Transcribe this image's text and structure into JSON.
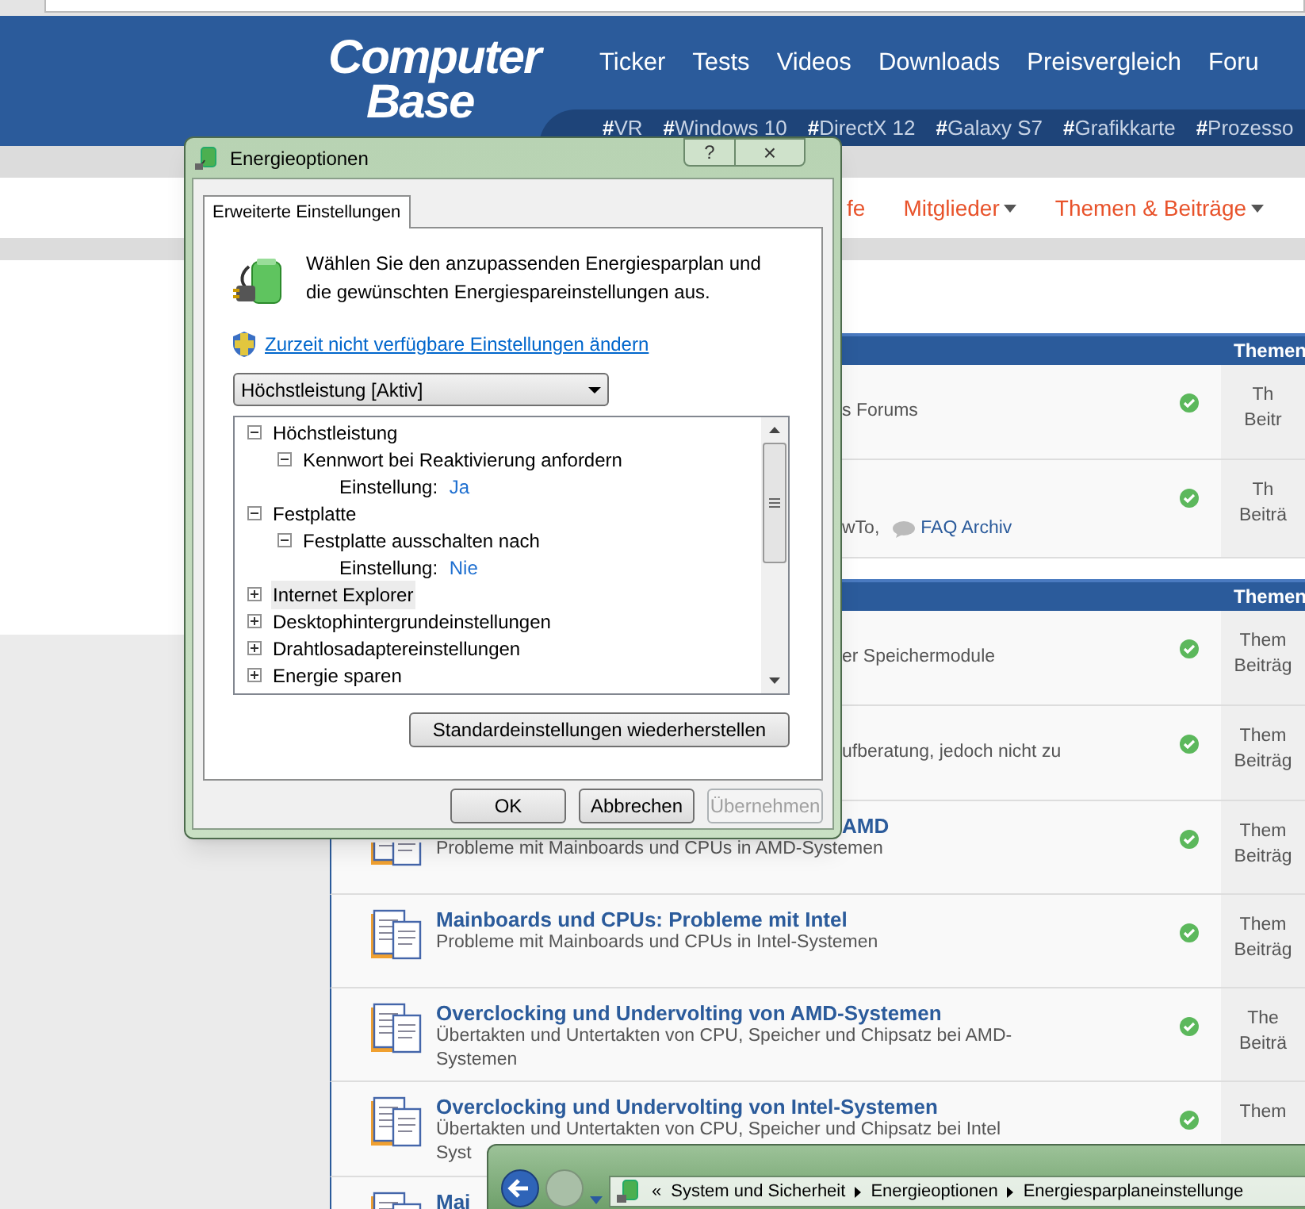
{
  "site": {
    "logo": {
      "line_1": "Computer",
      "line_2": "Base"
    },
    "nav": [
      "Ticker",
      "Tests",
      "Videos",
      "Downloads",
      "Preisvergleich",
      "Foru"
    ],
    "tags": [
      "VR",
      "Windows 10",
      "DirectX 12",
      "Galaxy S7",
      "Grafikkarte",
      "Prozesso"
    ],
    "tag_mark": "#",
    "subnav": [
      {
        "label": "fe",
        "dropdown": false
      },
      {
        "label": "Mitglieder",
        "dropdown": true
      },
      {
        "label": "Themen & Beiträge",
        "dropdown": true
      }
    ]
  },
  "forum_sections": [
    {
      "header": "Themen",
      "rows": [
        {
          "kind": "covered",
          "description": [
            "s Forums"
          ],
          "read": true,
          "stats": [
            "Th",
            "Beitr"
          ]
        },
        {
          "kind": "covered",
          "description": [
            "wTo,"
          ],
          "link": "FAQ Archiv",
          "read": true,
          "stats": [
            "Th",
            "Beiträ"
          ]
        }
      ]
    },
    {
      "header": "Themen",
      "rows": [
        {
          "kind": "covered",
          "description": [
            "er Speichermodule"
          ],
          "read": true,
          "stats": [
            "Them",
            "Beiträg"
          ]
        },
        {
          "kind": "covered",
          "description": [
            "ufberatung, jedoch nicht zu"
          ],
          "read": true,
          "stats": [
            "Them",
            "Beiträg"
          ]
        },
        {
          "kind": "title_covered",
          "title": "AMD",
          "description": [
            "Probleme mit Mainboards und CPUs in AMD-Systemen"
          ],
          "read": true,
          "stats": [
            "Them",
            "Beiträg"
          ]
        },
        {
          "kind": "full",
          "title": "Mainboards und CPUs: Probleme mit Intel",
          "description": [
            "Probleme mit Mainboards und CPUs in Intel-Systemen"
          ],
          "read": true,
          "stats": [
            "Them",
            "Beiträg"
          ]
        },
        {
          "kind": "full",
          "title": "Overclocking und Undervolting von AMD-Systemen",
          "description": [
            "Übertakten und Untertakten von CPU, Speicher und Chipsatz bei AMD-",
            "Systemen"
          ],
          "read": true,
          "stats": [
            "The",
            "Beiträ"
          ]
        },
        {
          "kind": "full",
          "title": "Overclocking und Undervolting von Intel-Systemen",
          "description": [
            "Übertakten und Untertakten von CPU, Speicher und Chipsatz bei Intel",
            "Syst"
          ],
          "read": true,
          "stats": [
            "Them"
          ]
        },
        {
          "kind": "full",
          "title": "Mai",
          "description": [],
          "stats": []
        }
      ]
    }
  ],
  "dialog": {
    "title": "Energieoptionen",
    "help": "?",
    "close": "×",
    "tabs": [
      {
        "label": "Erweiterte Einstellungen",
        "selected": true
      }
    ],
    "intro": "Wählen Sie den anzupassenden Energiesparplan und die gewünschten Energiespareinstellungen aus.",
    "admin_link": "Zurzeit nicht verfügbare Einstellungen ändern",
    "plan_select": {
      "value": "Höchstleistung [Aktiv]"
    },
    "tree": [
      {
        "label": "Höchstleistung",
        "expanded": true,
        "selected": false,
        "children": [
          {
            "label": "Kennwort bei Reaktivierung anfordern",
            "expanded": true,
            "selected": false,
            "children": [
              {
                "kind": "setting",
                "label": "Einstellung:",
                "value": "Ja",
                "selected": false
              }
            ]
          }
        ]
      },
      {
        "label": "Festplatte",
        "expanded": true,
        "selected": false,
        "children": [
          {
            "label": "Festplatte ausschalten nach",
            "expanded": true,
            "selected": false,
            "children": [
              {
                "kind": "setting",
                "label": "Einstellung:",
                "value": "Nie",
                "selected": false
              }
            ]
          }
        ]
      },
      {
        "label": "Internet Explorer",
        "expanded": false,
        "selected": true
      },
      {
        "label": "Desktophintergrundeinstellungen",
        "expanded": false,
        "selected": false
      },
      {
        "label": "Drahtlosadaptereinstellungen",
        "expanded": false,
        "selected": false
      },
      {
        "label": "Energie sparen",
        "expanded": false,
        "selected": false
      }
    ],
    "restore_button": "Standardeinstellungen wiederherstellen",
    "buttons": [
      {
        "label": "OK",
        "disabled": false
      },
      {
        "label": "Abbrechen",
        "disabled": false
      },
      {
        "label": "Übernehmen",
        "disabled": true
      }
    ]
  },
  "explorer": {
    "breadcrumb_overflow": "«",
    "breadcrumbs": [
      "System und Sicherheit",
      "Energieoptionen",
      "Energiesparplaneinstellunge"
    ]
  }
}
